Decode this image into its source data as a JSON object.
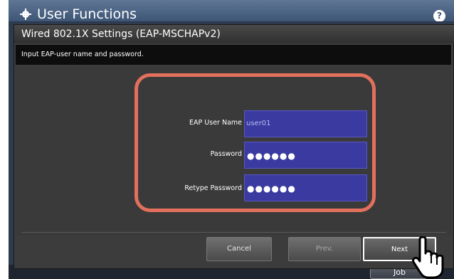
{
  "background": {
    "title": "User Functions",
    "help_label": "?",
    "job_label": "Job"
  },
  "dialog": {
    "title": "Wired 802.1X Settings (EAP-MSCHAPv2)",
    "instruction": "Input EAP-user name and password.",
    "fields": [
      {
        "label": "EAP User Name",
        "value": "user01"
      },
      {
        "label": "Password",
        "value": "●●●●●●"
      },
      {
        "label": "Retype Password",
        "value": "●●●●●●"
      }
    ],
    "buttons": {
      "cancel": "Cancel",
      "prev": "Prev.",
      "next": "Next"
    }
  },
  "colors": {
    "highlight": "#e2705c",
    "field_bg": "#3a3aa0"
  }
}
